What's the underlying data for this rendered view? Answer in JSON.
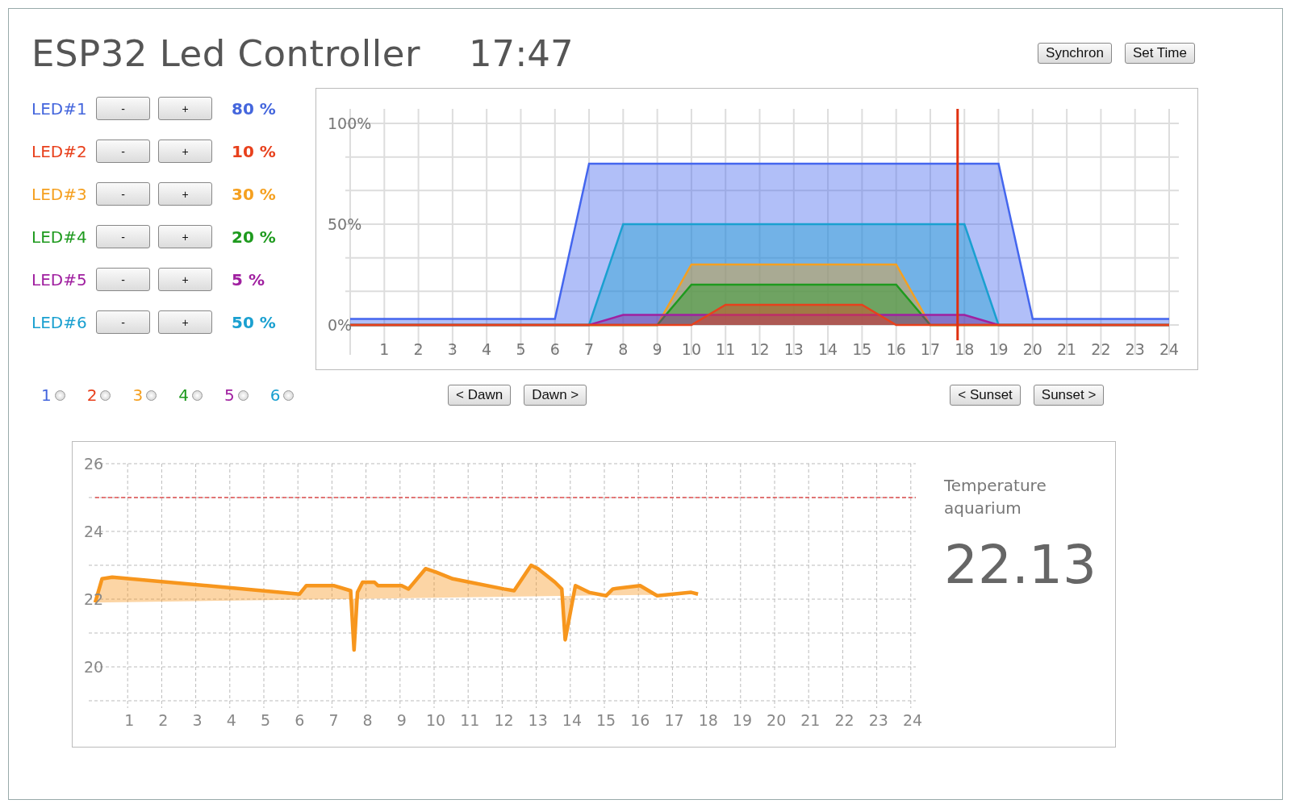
{
  "header": {
    "title": "ESP32 Led Controller",
    "time": "17:47",
    "buttons": [
      "Synchron",
      "Set Time"
    ]
  },
  "leds": [
    {
      "label": "LED#1",
      "color": "#4466dd",
      "minus": "-",
      "plus": "+",
      "value": "80 %"
    },
    {
      "label": "LED#2",
      "color": "#e8401c",
      "minus": "-",
      "plus": "+",
      "value": "10 %"
    },
    {
      "label": "LED#3",
      "color": "#f5a020",
      "minus": "-",
      "plus": "+",
      "value": "30 %"
    },
    {
      "label": "LED#4",
      "color": "#1e9a1e",
      "minus": "-",
      "plus": "+",
      "value": "20 %"
    },
    {
      "label": "LED#5",
      "color": "#a020a0",
      "minus": "-",
      "plus": "+",
      "value": "5 %"
    },
    {
      "label": "LED#6",
      "color": "#1aa0d0",
      "minus": "-",
      "plus": "+",
      "value": "50 %"
    }
  ],
  "led_chart": {
    "chart_data": {
      "type": "area",
      "x": [
        0,
        1,
        2,
        3,
        4,
        5,
        6,
        7,
        8,
        9,
        10,
        11,
        12,
        13,
        14,
        15,
        16,
        17,
        18,
        19,
        20,
        21,
        22,
        23,
        24
      ],
      "ylim": [
        0,
        100
      ],
      "xlim": [
        0,
        24
      ],
      "yticks": [
        {
          "value": 0,
          "label": "0%"
        },
        {
          "value": 50,
          "label": "50%"
        },
        {
          "value": 100,
          "label": "100%"
        }
      ],
      "xticks": [
        1,
        2,
        3,
        4,
        5,
        6,
        7,
        8,
        9,
        10,
        11,
        12,
        13,
        14,
        15,
        16,
        17,
        18,
        19,
        20,
        21,
        22,
        23,
        24
      ],
      "grid": true,
      "series": [
        {
          "color": "#4466ee",
          "values": [
            3,
            3,
            3,
            3,
            3,
            3,
            3,
            80,
            80,
            80,
            80,
            80,
            80,
            80,
            80,
            80,
            80,
            80,
            80,
            80,
            3,
            3,
            3,
            3,
            3
          ]
        },
        {
          "color": "#1aa0d0",
          "values": [
            0,
            0,
            0,
            0,
            0,
            0,
            0,
            0,
            50,
            50,
            50,
            50,
            50,
            50,
            50,
            50,
            50,
            50,
            50,
            0,
            0,
            0,
            0,
            0,
            0
          ]
        },
        {
          "color": "#f5a020",
          "values": [
            0,
            0,
            0,
            0,
            0,
            0,
            0,
            0,
            0,
            0,
            30,
            30,
            30,
            30,
            30,
            30,
            30,
            0,
            0,
            0,
            0,
            0,
            0,
            0,
            0
          ]
        },
        {
          "color": "#1e9a1e",
          "values": [
            0,
            0,
            0,
            0,
            0,
            0,
            0,
            0,
            0,
            0,
            20,
            20,
            20,
            20,
            20,
            20,
            20,
            0,
            0,
            0,
            0,
            0,
            0,
            0,
            0
          ]
        },
        {
          "color": "#a020a0",
          "values": [
            0,
            0,
            0,
            0,
            0,
            0,
            0,
            0,
            5,
            5,
            5,
            5,
            5,
            5,
            5,
            5,
            5,
            5,
            5,
            0,
            0,
            0,
            0,
            0,
            0
          ]
        },
        {
          "color": "#e8401c",
          "values": [
            0,
            0,
            0,
            0,
            0,
            0,
            0,
            0,
            0,
            0,
            0,
            10,
            10,
            10,
            10,
            10,
            0,
            0,
            0,
            0,
            0,
            0,
            0,
            0,
            0
          ]
        }
      ],
      "ref_lines": [
        {
          "axis": "x",
          "value": 17.8,
          "color": "#e03010"
        }
      ]
    }
  },
  "selectors": [
    {
      "label": "1",
      "color": "#4466dd",
      "selected": false
    },
    {
      "label": "2",
      "color": "#e8401c",
      "selected": false
    },
    {
      "label": "3",
      "color": "#f5a020",
      "selected": false
    },
    {
      "label": "4",
      "color": "#1e9a1e",
      "selected": false
    },
    {
      "label": "5",
      "color": "#a020a0",
      "selected": false
    },
    {
      "label": "6",
      "color": "#1aa0d0",
      "selected": false
    }
  ],
  "dawn_buttons": [
    "< Dawn",
    "Dawn >"
  ],
  "sunset_buttons": [
    "< Sunset",
    "Sunset >"
  ],
  "temperature": {
    "label": "Temperature aquarium",
    "reading": "22.13",
    "chart_data": {
      "type": "area",
      "xlim": [
        0,
        24
      ],
      "ylim": [
        19,
        26
      ],
      "yticks": [
        20,
        22,
        24,
        26
      ],
      "grid": true,
      "xticks": [
        1,
        2,
        3,
        4,
        5,
        6,
        7,
        8,
        9,
        10,
        11,
        12,
        13,
        14,
        15,
        16,
        17,
        18,
        19,
        20,
        21,
        22,
        23,
        24
      ],
      "x": [
        0,
        0.2,
        0.5,
        6,
        6.2,
        7,
        7.5,
        7.6,
        7.7,
        7.85,
        8.2,
        8.3,
        9,
        9.2,
        9.7,
        10,
        10.5,
        11,
        12,
        12.3,
        12.8,
        13,
        13.5,
        13.7,
        13.8,
        14.1,
        14.5,
        15,
        15.2,
        16,
        16.5,
        17.5,
        17.7
      ],
      "series": [
        {
          "color": "#f7961d",
          "values": [
            21.9,
            22.6,
            22.65,
            22.15,
            22.4,
            22.4,
            22.25,
            20.5,
            22.2,
            22.5,
            22.5,
            22.4,
            22.4,
            22.3,
            22.9,
            22.8,
            22.6,
            22.5,
            22.3,
            22.25,
            23.0,
            22.9,
            22.5,
            22.3,
            20.8,
            22.4,
            22.2,
            22.1,
            22.3,
            22.4,
            22.1,
            22.2,
            22.15
          ]
        }
      ],
      "ref_lines": [
        {
          "axis": "y",
          "value": 25,
          "color": "#e05050"
        }
      ]
    }
  }
}
